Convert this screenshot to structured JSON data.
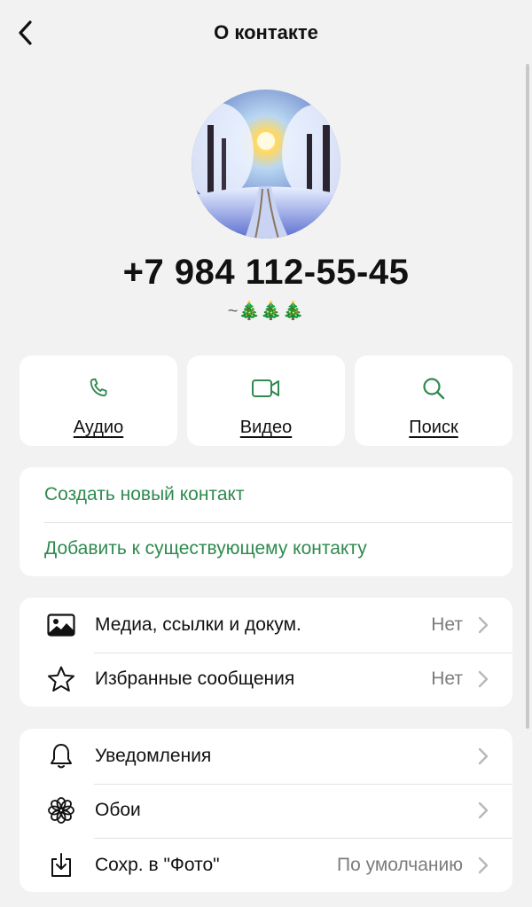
{
  "header": {
    "title": "О контакте"
  },
  "profile": {
    "phone": "+7 984 112-55-45",
    "about": "~🎄🎄🎄"
  },
  "actions": [
    {
      "label": "Аудио",
      "icon": "phone-icon"
    },
    {
      "label": "Видео",
      "icon": "video-icon"
    },
    {
      "label": "Поиск",
      "icon": "search-icon"
    }
  ],
  "contact_options": [
    {
      "label": "Создать новый контакт"
    },
    {
      "label": "Добавить к существующему контакту"
    }
  ],
  "media_section": [
    {
      "label": "Медиа, ссылки и докум.",
      "value": "Нет",
      "icon": "image-icon"
    },
    {
      "label": "Избранные сообщения",
      "value": "Нет",
      "icon": "star-icon"
    }
  ],
  "settings_section": [
    {
      "label": "Уведомления",
      "value": "",
      "icon": "bell-icon"
    },
    {
      "label": "Обои",
      "value": "",
      "icon": "wallpaper-icon"
    },
    {
      "label": "Сохр. в \"Фото\"",
      "value": "По умолчанию",
      "icon": "download-icon"
    }
  ],
  "colors": {
    "accent": "#2e8a4f",
    "background": "#f2f2f2"
  }
}
